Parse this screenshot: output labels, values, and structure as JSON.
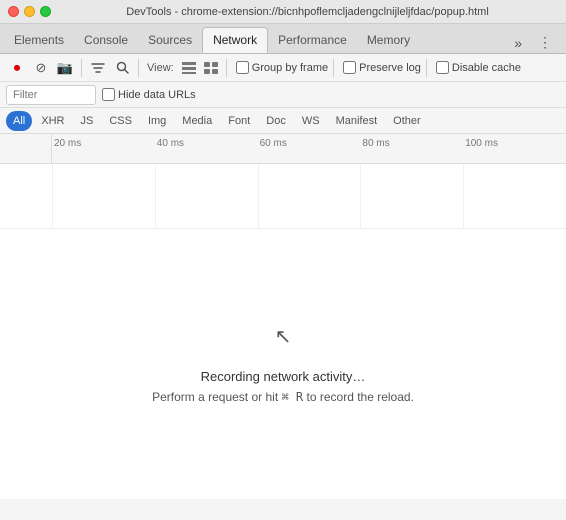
{
  "window": {
    "title": "DevTools - chrome-extension://bicnhpoflemcljadengclnijleljfdac/popup.html"
  },
  "main_tabs": [
    {
      "id": "elements",
      "label": "Elements",
      "active": false
    },
    {
      "id": "console",
      "label": "Console",
      "active": false
    },
    {
      "id": "sources",
      "label": "Sources",
      "active": false
    },
    {
      "id": "network",
      "label": "Network",
      "active": true
    },
    {
      "id": "performance",
      "label": "Performance",
      "active": false
    },
    {
      "id": "memory",
      "label": "Memory",
      "active": false
    }
  ],
  "toolbar": {
    "record_tooltip": "Record",
    "stop_tooltip": "Stop",
    "camera_tooltip": "Capture screenshot",
    "filter_tooltip": "Filter",
    "search_tooltip": "Search",
    "view_label": "View:",
    "list_view_tooltip": "Use large request rows",
    "group_view_tooltip": "Group by frame",
    "group_by_frame_label": "Group by frame",
    "preserve_log_label": "Preserve log",
    "disable_cache_label": "Disable cache"
  },
  "filter_bar": {
    "filter_placeholder": "Filter",
    "hide_data_urls_label": "Hide data URLs"
  },
  "type_filters": [
    {
      "id": "all",
      "label": "All",
      "active": true
    },
    {
      "id": "xhr",
      "label": "XHR",
      "active": false
    },
    {
      "id": "js",
      "label": "JS",
      "active": false
    },
    {
      "id": "css",
      "label": "CSS",
      "active": false
    },
    {
      "id": "img",
      "label": "Img",
      "active": false
    },
    {
      "id": "media",
      "label": "Media",
      "active": false
    },
    {
      "id": "font",
      "label": "Font",
      "active": false
    },
    {
      "id": "doc",
      "label": "Doc",
      "active": false
    },
    {
      "id": "ws",
      "label": "WS",
      "active": false
    },
    {
      "id": "manifest",
      "label": "Manifest",
      "active": false
    },
    {
      "id": "other",
      "label": "Other",
      "active": false
    }
  ],
  "timeline": {
    "ticks": [
      {
        "label": "20 ms",
        "pct": 0
      },
      {
        "label": "40 ms",
        "pct": 20
      },
      {
        "label": "60 ms",
        "pct": 40
      },
      {
        "label": "80 ms",
        "pct": 60
      },
      {
        "label": "100 ms",
        "pct": 80
      }
    ]
  },
  "empty_state": {
    "recording_text": "Recording network activity…",
    "instruction_prefix": "Perform a request or hit ",
    "shortcut": "⌘ R",
    "instruction_suffix": " to record the reload."
  }
}
